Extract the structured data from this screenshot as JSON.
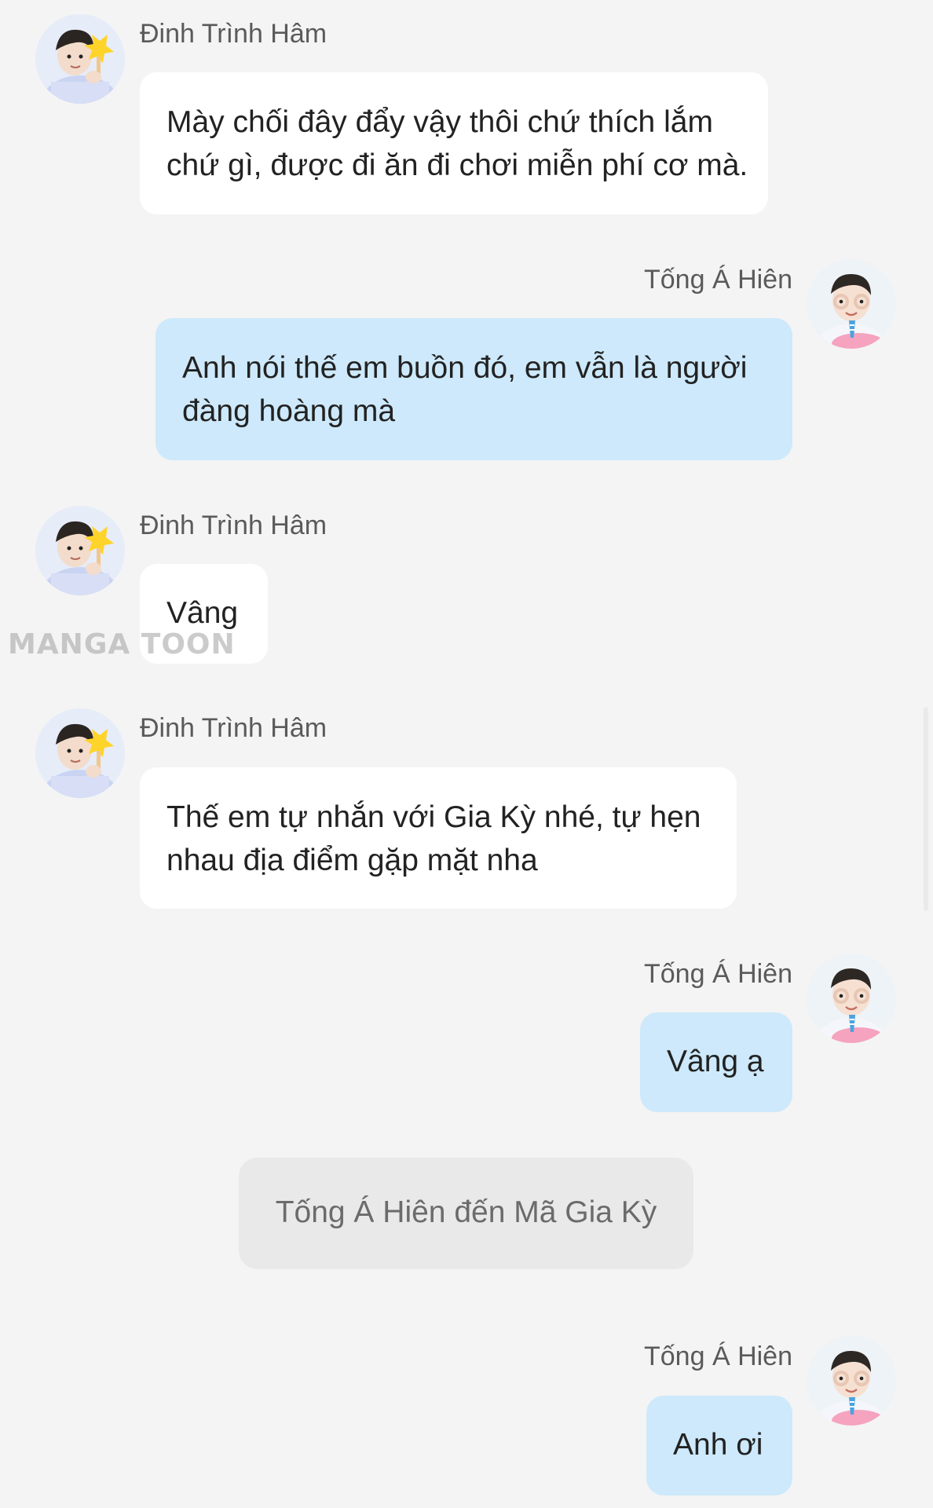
{
  "messages": [
    {
      "sender": "Đinh Trình Hâm",
      "side": "left",
      "lines": [
        "Mày chối đây đẩy vậy thôi chứ thích lắm",
        "chứ gì, được đi ăn đi chơi miễn phí cơ mà."
      ]
    },
    {
      "sender": "Tống Á Hiên",
      "side": "right",
      "lines": [
        "Anh nói thế em buồn đó, em vẫn là người",
        "đàng hoàng mà"
      ]
    },
    {
      "sender": "Đinh Trình Hâm",
      "side": "left",
      "lines": [
        "Vâng"
      ]
    },
    {
      "sender": "Đinh Trình Hâm",
      "side": "left",
      "lines": [
        "Thế em tự nhắn với Gia Kỳ nhé, tự hẹn",
        "nhau địa điểm gặp mặt nha"
      ]
    },
    {
      "sender": "Tống Á Hiên",
      "side": "right",
      "lines": [
        "Vâng ạ"
      ]
    },
    {
      "sender": "Tống Á Hiên",
      "side": "right",
      "lines": [
        "Anh ơi"
      ]
    }
  ],
  "system_message": "Tống Á Hiên đến Mã Gia Kỳ",
  "watermark": "MANGA TOON",
  "avatars": {
    "dinh": {
      "name": "Đinh Trình Hâm",
      "icon": "avatar-photo-icon"
    },
    "tong": {
      "name": "Tống Á Hiên",
      "icon": "avatar-photo-icon"
    }
  },
  "colors": {
    "background": "#f4f4f4",
    "bubble_left": "#ffffff",
    "bubble_right": "#cde9fb",
    "system_bubble": "#e9e9e9",
    "name_text": "#5a5a5a"
  }
}
